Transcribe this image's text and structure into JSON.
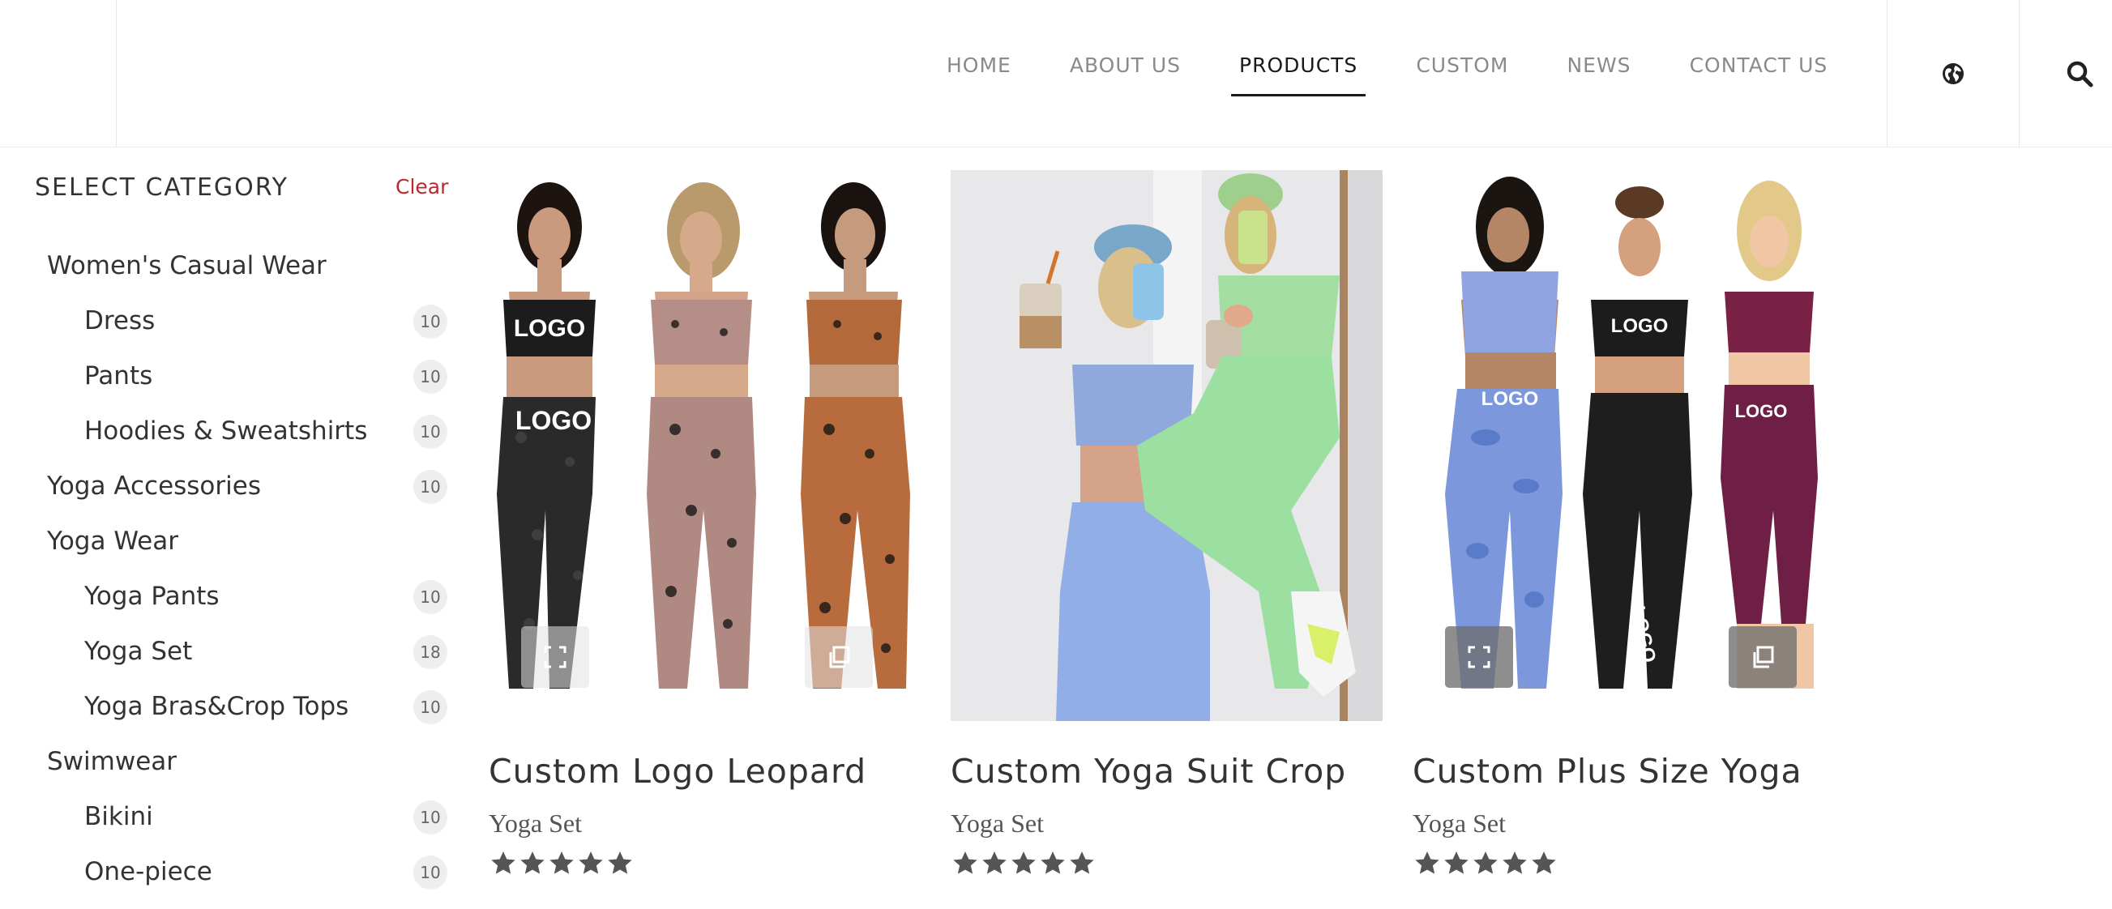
{
  "nav": {
    "items": [
      "HOME",
      "ABOUT US",
      "PRODUCTS",
      "CUSTOM",
      "NEWS",
      "CONTACT US"
    ],
    "active": "PRODUCTS",
    "language_icon": "globe-icon",
    "search_icon": "search-icon"
  },
  "sidebar": {
    "title": "SELECT CATEGORY",
    "clear_label": "Clear",
    "categories": [
      {
        "label": "Women's Casual Wear",
        "level": 0,
        "count": null
      },
      {
        "label": "Dress",
        "level": 1,
        "count": "10"
      },
      {
        "label": "Pants",
        "level": 1,
        "count": "10"
      },
      {
        "label": "Hoodies & Sweatshirts",
        "level": 1,
        "count": "10"
      },
      {
        "label": "Yoga Accessories",
        "level": 0,
        "count": "10"
      },
      {
        "label": "Yoga Wear",
        "level": 0,
        "count": null
      },
      {
        "label": "Yoga Pants",
        "level": 1,
        "count": "10"
      },
      {
        "label": "Yoga Set",
        "level": 1,
        "count": "18"
      },
      {
        "label": "Yoga Bras&Crop Tops",
        "level": 1,
        "count": "10"
      },
      {
        "label": "Swimwear",
        "level": 0,
        "count": null
      },
      {
        "label": "Bikini",
        "level": 1,
        "count": "10"
      },
      {
        "label": "One-piece",
        "level": 1,
        "count": "10"
      }
    ]
  },
  "products": [
    {
      "title": "Custom Logo Leopard",
      "category": "Yoga Set",
      "rating": 5,
      "image_text": [
        "LOGO",
        "LOGO"
      ]
    },
    {
      "title": "Custom Yoga Suit Crop",
      "category": "Yoga Set",
      "rating": 5,
      "image_text": []
    },
    {
      "title": "Custom Plus Size Yoga",
      "category": "Yoga Set",
      "rating": 5,
      "image_text": [
        "LOGO",
        "LOGO",
        "LOGO",
        "LOGO"
      ]
    }
  ],
  "colors": {
    "accent_red": "#c0272d",
    "nav_active": "#1a1a1a",
    "nav_inactive": "#8a8a8a",
    "star": "#555555",
    "count_badge_bg": "#eeeeee"
  }
}
